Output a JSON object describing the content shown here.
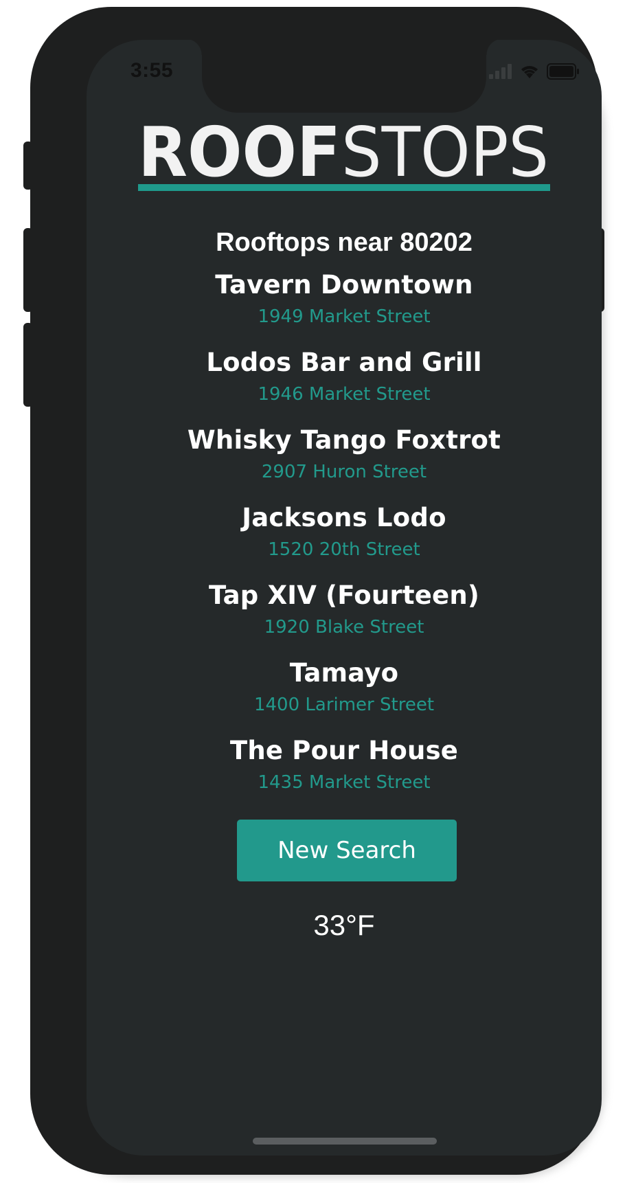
{
  "status_bar": {
    "time": "3:55",
    "icons": [
      "signal-icon",
      "wifi-icon",
      "battery-icon"
    ]
  },
  "app": {
    "logo_bold": "ROOF",
    "logo_light": "STOPS",
    "accent_color": "#22998c",
    "background_color": "#25292a"
  },
  "results": {
    "heading": "Rooftops near 80202",
    "venues": [
      {
        "name": "Tavern Downtown",
        "address": "1949 Market Street"
      },
      {
        "name": "Lodos Bar and Grill",
        "address": "1946 Market Street"
      },
      {
        "name": "Whisky Tango Foxtrot",
        "address": "2907 Huron Street"
      },
      {
        "name": "Jacksons Lodo",
        "address": "1520 20th Street"
      },
      {
        "name": "Tap XIV (Fourteen)",
        "address": "1920 Blake Street"
      },
      {
        "name": "Tamayo",
        "address": "1400 Larimer Street"
      },
      {
        "name": "The Pour House",
        "address": "1435 Market Street"
      }
    ]
  },
  "actions": {
    "new_search_label": "New Search"
  },
  "weather": {
    "temperature": "33°F"
  }
}
